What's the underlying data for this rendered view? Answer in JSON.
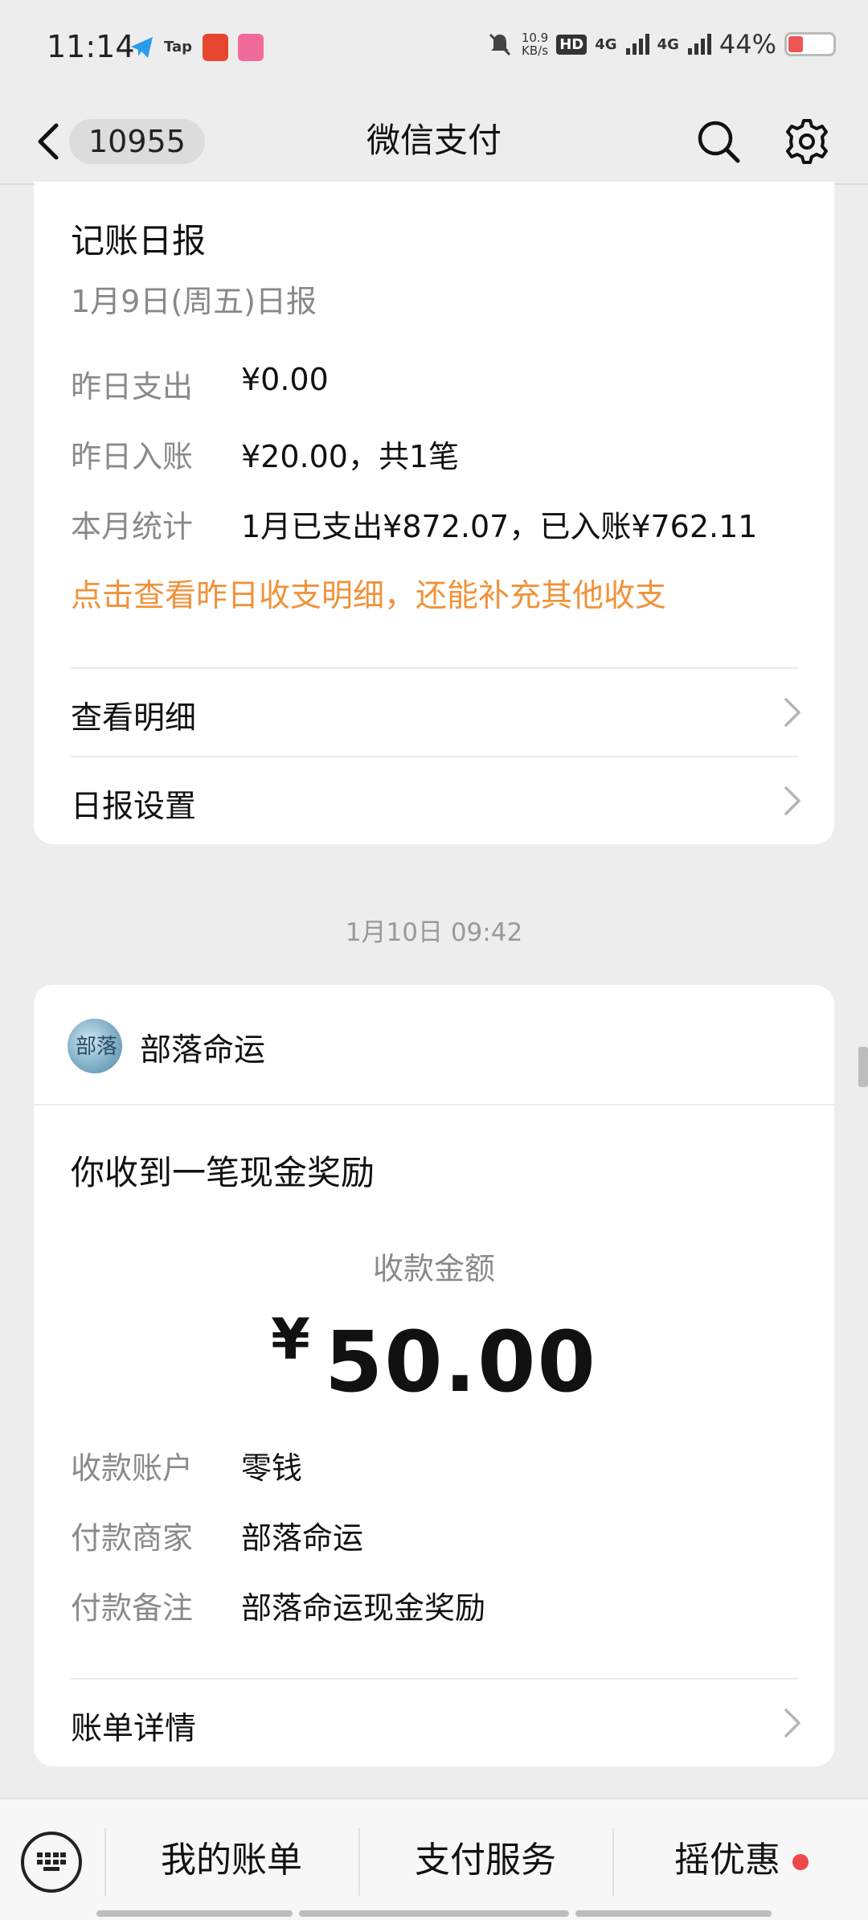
{
  "status_bar": {
    "time": "11:14",
    "app_icons": [
      "telegram-icon",
      "tap-icon",
      "game-app-icon",
      "bilibili-icon"
    ],
    "network_speed": "10.9",
    "network_speed_unit": "KB/s",
    "hd_label": "HD",
    "signal_1": "4G",
    "signal_2": "4G",
    "battery": "44%"
  },
  "nav": {
    "unread_count": "10955",
    "title": "微信支付"
  },
  "daily_report": {
    "title": "记账日报",
    "date": "1月9日(周五)日报",
    "rows": [
      {
        "label": "昨日支出",
        "value": "¥0.00"
      },
      {
        "label": "昨日入账",
        "value": "¥20.00，共1笔"
      },
      {
        "label": "本月统计",
        "value": "1月已支出¥872.07，已入账¥762.11"
      }
    ],
    "link": "点击查看昨日收支明细，还能补充其他收支",
    "actions": [
      {
        "label": "查看明细"
      },
      {
        "label": "日报设置"
      }
    ]
  },
  "timestamp": "1月10日 09:42",
  "reward": {
    "logo_text": "部落",
    "merchant": "部落命运",
    "title": "你收到一笔现金奖励",
    "amount_label": "收款金额",
    "currency": "¥",
    "amount": "50.00",
    "rows": [
      {
        "label": "收款账户",
        "value": "零钱"
      },
      {
        "label": "付款商家",
        "value": "部落命运"
      },
      {
        "label": "付款备注",
        "value": "部落命运现金奖励"
      }
    ],
    "detail_link": "账单详情"
  },
  "bottom_bar": {
    "tabs": [
      {
        "label": "我的账单"
      },
      {
        "label": "支付服务"
      },
      {
        "label": "摇优惠"
      }
    ]
  },
  "colors": {
    "accent_orange": "#f0923a",
    "red_dot": "#f04848"
  }
}
